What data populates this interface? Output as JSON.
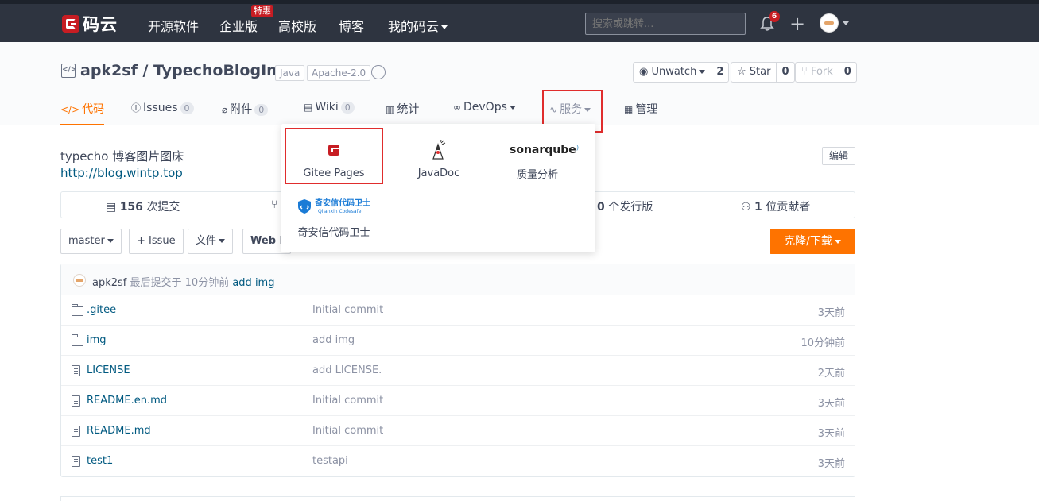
{
  "topnav": {
    "logo_text": "码云",
    "items": [
      "开源软件",
      "企业版",
      "高校版",
      "博客",
      "我的码云"
    ],
    "special_badge": "特惠",
    "search_placeholder": "搜索或跳转...",
    "notification_count": "6"
  },
  "repo": {
    "title": "apk2sf / TypechoBlogImg",
    "tags": [
      "Java",
      "Apache-2.0"
    ],
    "watch": {
      "label": "Unwatch",
      "count": "2"
    },
    "star": {
      "label": "Star",
      "count": "0"
    },
    "fork": {
      "label": "Fork",
      "count": "0"
    }
  },
  "tabs": [
    {
      "label": "代码",
      "icon": "code-icon"
    },
    {
      "label": "Issues",
      "icon": "issue-icon",
      "count": "0"
    },
    {
      "label": "附件",
      "icon": "attachment-icon",
      "count": "0"
    },
    {
      "label": "Wiki",
      "icon": "wiki-icon",
      "count": "0"
    },
    {
      "label": "统计",
      "icon": "chart-icon"
    },
    {
      "label": "DevOps",
      "icon": "devops-icon"
    },
    {
      "label": "服务",
      "icon": "pulse-icon"
    },
    {
      "label": "管理",
      "icon": "manage-icon"
    }
  ],
  "services_dropdown": {
    "items": [
      {
        "label": "Gitee Pages",
        "icon": "gitee-icon"
      },
      {
        "label": "JavaDoc",
        "icon": "java-icon"
      },
      {
        "label": "质量分析",
        "icon": "sonarqube-icon",
        "logo_text": "sonarqube"
      },
      {
        "label": "奇安信代码卫士",
        "icon": "qianxin-icon",
        "logo_text": "奇安信代码卫士",
        "logo_sub": "Qi'anxin Codesafe"
      }
    ]
  },
  "main": {
    "description": "typecho 博客图片图床",
    "link": "http://blog.wintp.top",
    "edit_label": "编辑",
    "stats": {
      "commits_count": "156",
      "commits_label": "次提交",
      "releases_count": "0",
      "releases_label": "个发行版",
      "contributors_count": "1",
      "contributors_label": "位贡献者"
    },
    "branch_label": "master",
    "issue_btn": "+ Issue",
    "file_btn": "文件",
    "web_btn": "Web I",
    "clone_btn": "克隆/下载",
    "last_commit": {
      "user": "apk2sf",
      "text": "最后提交于 10分钟前",
      "message": "add img"
    },
    "files": [
      {
        "name": ".gitee",
        "type": "folder",
        "message": "Initial commit",
        "time": "3天前"
      },
      {
        "name": "img",
        "type": "folder",
        "message": "add img",
        "time": "10分钟前"
      },
      {
        "name": "LICENSE",
        "type": "file",
        "message": "add LICENSE.",
        "time": "2天前"
      },
      {
        "name": "README.en.md",
        "type": "file",
        "message": "Initial commit",
        "time": "3天前"
      },
      {
        "name": "README.md",
        "type": "file",
        "message": "Initial commit",
        "time": "3天前"
      },
      {
        "name": "test1",
        "type": "file",
        "message": "testapi",
        "time": "3天前"
      }
    ]
  },
  "colors": {
    "accent": "#fe7300",
    "highlight_border": "#e02d2d",
    "nav_bg": "#2e3440",
    "link": "#005980"
  }
}
